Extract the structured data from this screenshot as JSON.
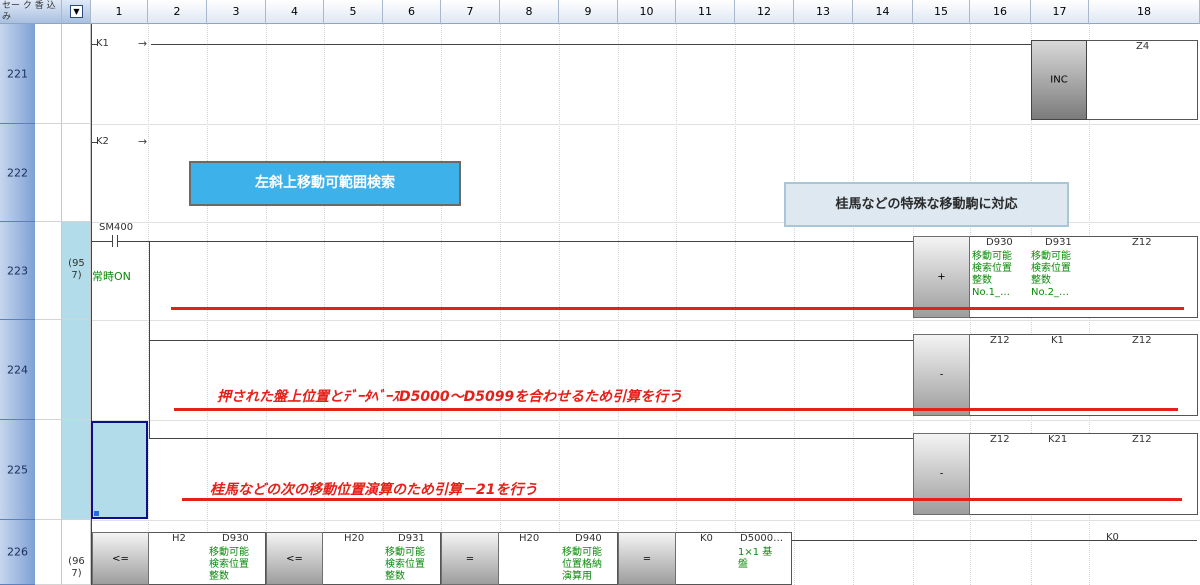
{
  "header": {
    "first_label": "セー ク 香 込 み",
    "toggle_icon": "dropdown-icon",
    "columns": [
      "1",
      "2",
      "3",
      "4",
      "5",
      "6",
      "7",
      "8",
      "9",
      "10",
      "11",
      "12",
      "13",
      "14",
      "15",
      "16",
      "17",
      "18"
    ]
  },
  "rows": [
    {
      "id": "221",
      "step": ""
    },
    {
      "id": "222",
      "step": ""
    },
    {
      "id": "223",
      "step": "(95\n7)"
    },
    {
      "id": "224",
      "step": ""
    },
    {
      "id": "225",
      "step": ""
    },
    {
      "id": "226",
      "step": "(96\n7)"
    }
  ],
  "r221": {
    "contact": "K1",
    "instr": "INC",
    "operand": "Z4"
  },
  "r222": {
    "contact": "K2"
  },
  "r223": {
    "contact": "SM400",
    "contact_comment": "常時ON",
    "instr": "+",
    "op1": "D930",
    "op1_comment": "移動可能\n検索位置\n整数\nNo.1_…",
    "op2": "D931",
    "op2_comment": "移動可能\n検索位置\n整数\nNo.2_…",
    "dest": "Z12"
  },
  "r224": {
    "instr": "-",
    "op1": "Z12",
    "op2": "K1",
    "dest": "Z12"
  },
  "r225": {
    "instr": "-",
    "op1": "Z12",
    "op2": "K21",
    "dest": "Z12"
  },
  "r226": {
    "c1_op": "<=",
    "c1_a": "H2",
    "c1_b": "D930",
    "c1_b_comment": "移動可能\n検索位置\n整数",
    "c2_op": "<=",
    "c2_a": "H20",
    "c2_b": "D931",
    "c2_b_comment": "移動可能\n検索位置\n整数",
    "c3_op": "=",
    "c3_a": "H20",
    "c3_b": "D940",
    "c3_b_comment": "移動可能\n位置格納\n演算用",
    "c4_op": "=",
    "c4_a": "K0",
    "c4_b": "D5000…",
    "c4_b_comment": "1×1 基\n盤",
    "right_label": "K0"
  },
  "notes": {
    "blue": "左斜上移動可範囲検索",
    "gray": "桂馬などの特殊な移動駒に対応",
    "red1": "押された盤上位置とﾃﾞｰﾀﾍﾞｰｽD5000～D5099を合わせるため引算を行う",
    "red2": "桂馬などの次の移動位置演算のため引算－21を行う"
  },
  "colors": {
    "annotation_red": "#e52019",
    "note_blue": "#3db1ea",
    "note_gray": "#dde8f0",
    "comment_green": "#0a8a0a",
    "cursor_fill": "#b3dcea",
    "rownum_blue": "#7ea0d4"
  }
}
